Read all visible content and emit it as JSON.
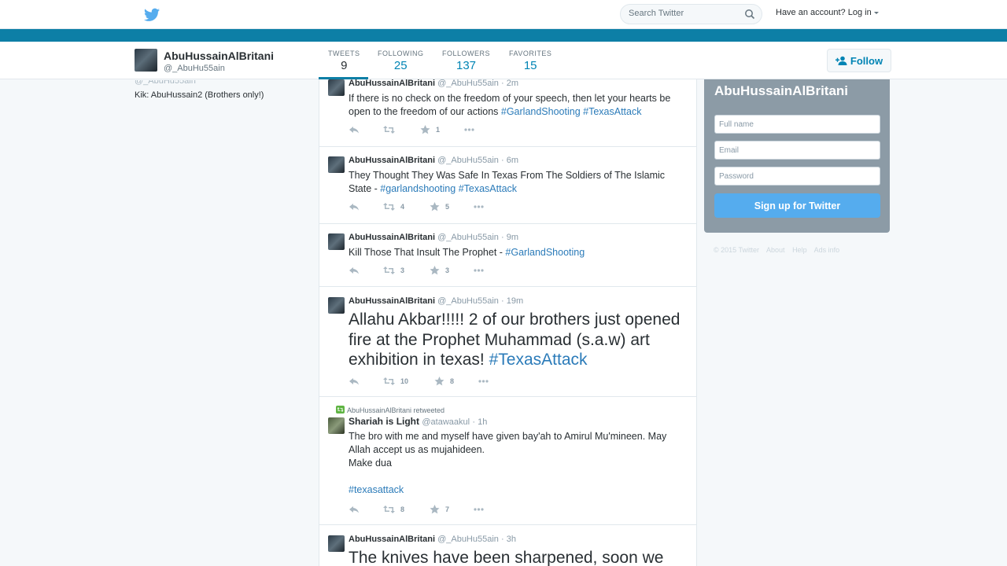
{
  "topbar": {
    "search_placeholder": "Search Twitter",
    "login_text": "Have an account? Log in"
  },
  "profile": {
    "name": "AbuHussainAlBritani",
    "handle": "@_AbuHu55ain",
    "bio_kik": "Kik: AbuHussain2 (Brothers only!)",
    "stats": [
      {
        "label": "TWEETS",
        "value": "9"
      },
      {
        "label": "FOLLOWING",
        "value": "25"
      },
      {
        "label": "FOLLOWERS",
        "value": "137"
      },
      {
        "label": "FAVORITES",
        "value": "15"
      }
    ],
    "follow_label": "Follow"
  },
  "tweets": [
    {
      "name": "AbuHussainAlBritani",
      "handle": "@_AbuHu55ain",
      "time": "· 2m",
      "text": "If there is no check on the freedom of your speech, then let your hearts be open to the freedom of our actions ",
      "tags": [
        "#GarlandShooting",
        "#TexasAttack"
      ],
      "retweets": "",
      "favorites": "1"
    },
    {
      "name": "AbuHussainAlBritani",
      "handle": "@_AbuHu55ain",
      "time": "· 6m",
      "text": "They Thought They Was Safe In Texas From The Soldiers of The Islamic State - ",
      "tags": [
        "#garlandshooting",
        "#TexasAttack"
      ],
      "retweets": "4",
      "favorites": "5"
    },
    {
      "name": "AbuHussainAlBritani",
      "handle": "@_AbuHu55ain",
      "time": "· 9m",
      "text": "Kill Those That Insult The Prophet - ",
      "tags": [
        "#GarlandShooting"
      ],
      "retweets": "3",
      "favorites": "3"
    },
    {
      "name": "AbuHussainAlBritani",
      "handle": "@_AbuHu55ain",
      "time": "· 19m",
      "text": "Allahu Akbar!!!!! 2 of our brothers just opened fire at the Prophet Muhammad (s.a.w) art exhibition in texas! ",
      "tags": [
        "#TexasAttack"
      ],
      "retweets": "10",
      "favorites": "8"
    },
    {
      "retweeted_by": "AbuHussainAlBritani retweeted",
      "name": "Shariah is Light",
      "handle": "@atawaakul",
      "time": "· 1h",
      "line1": "The bro with me and myself have given bay'ah to Amirul Mu'mineen. May Allah accept us as mujahideen.",
      "line2": "Make dua",
      "tags": [
        "#texasattack"
      ],
      "retweets": "8",
      "favorites": "7"
    },
    {
      "name": "AbuHussainAlBritani",
      "handle": "@_AbuHu55ain",
      "time": "· 3h",
      "text": "The knives have been sharpened, soon we"
    }
  ],
  "signup": {
    "title": "AbuHussainAlBritani",
    "full_name_placeholder": "Full name",
    "email_placeholder": "Email",
    "password_placeholder": "Password",
    "button_label": "Sign up for Twitter"
  },
  "footer": {
    "links": [
      "© 2015 Twitter",
      "About",
      "Help",
      "Ads info"
    ]
  },
  "colors": {
    "brand_blue": "#55acee",
    "banner": "#0d7fa6",
    "link": "#0084b4"
  }
}
